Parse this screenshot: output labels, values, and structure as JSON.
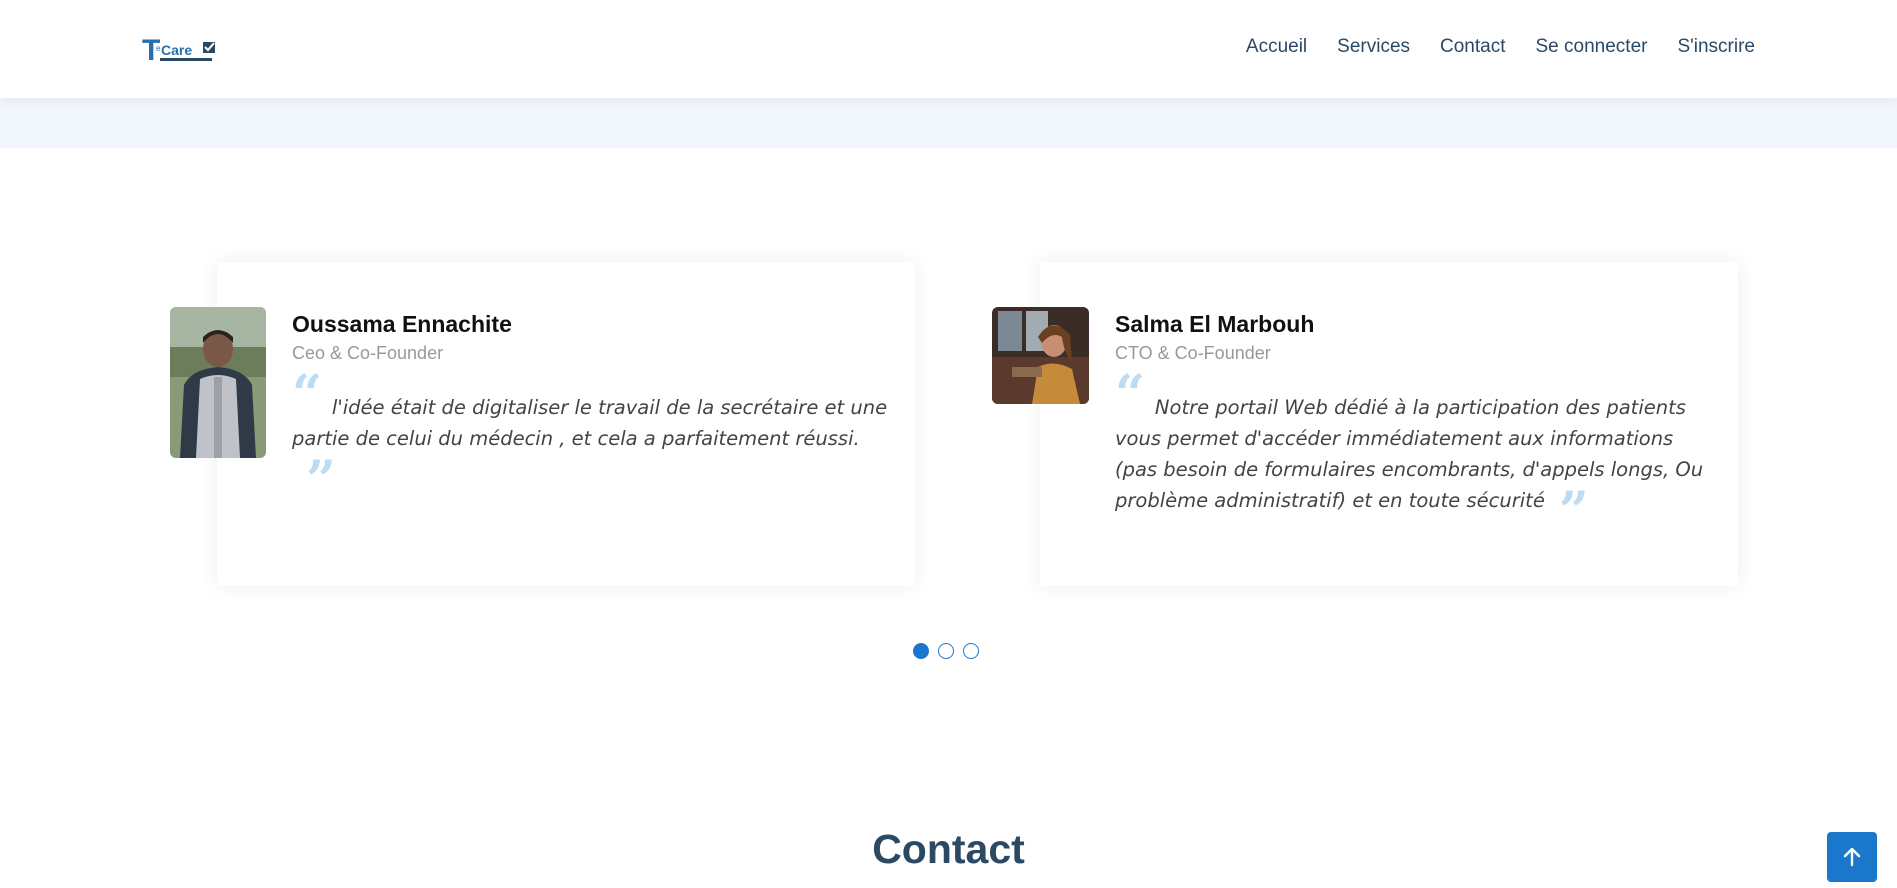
{
  "header": {
    "logo_text": "TeleCare",
    "nav": [
      {
        "label": "Accueil"
      },
      {
        "label": "Services"
      },
      {
        "label": "Contact"
      },
      {
        "label": "Se connecter"
      },
      {
        "label": "S'inscrire"
      }
    ]
  },
  "testimonials": [
    {
      "name": "Oussama Ennachite",
      "role": "Ceo & Co-Founder",
      "quote": "l'idée était de digitaliser le travail de la secrétaire et une partie de celui du médecin , et cela a parfaitement réussi."
    },
    {
      "name": "Salma El Marbouh",
      "role": "CTO & Co-Founder",
      "quote": "Notre portail Web dédié à la participation des patients vous permet d'accéder immédiatement aux informations (pas besoin de formulaires encombrants, d'appels longs, Ou problème administratif) et en toute sécurité"
    }
  ],
  "carousel": {
    "dots_total": 3,
    "active_dot": 1
  },
  "contact_section": {
    "title": "Contact"
  },
  "colors": {
    "accent": "#1977cc",
    "heading": "#2c4964",
    "quote_mark": "#bcdcf4",
    "band": "#f1f7fd"
  },
  "icons": {
    "back_to_top": "arrow-up-icon"
  }
}
